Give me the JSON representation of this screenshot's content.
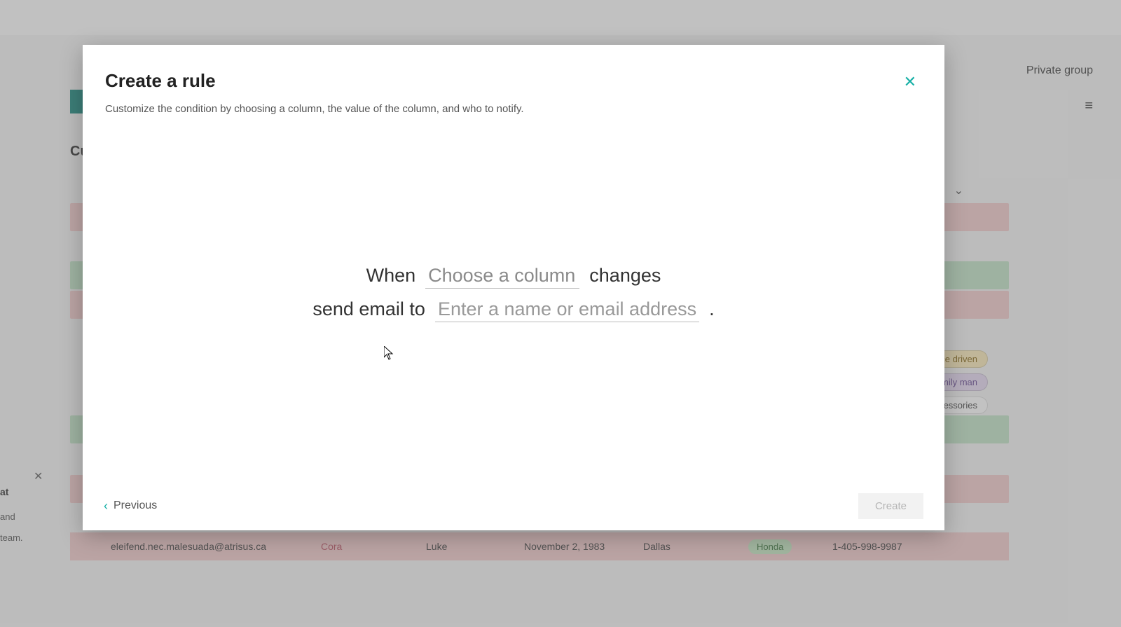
{
  "background": {
    "small_title": "",
    "private_label": "Private group",
    "left_at": "at",
    "left_and": "and",
    "left_team": "team.",
    "cu_label": "Cu",
    "tags": {
      "t1": "ce driven",
      "t2": "mily man",
      "t3": "ccessories"
    },
    "row": {
      "email": "eleifend.nec.malesuada@atrisus.ca",
      "c2": "Cora",
      "c3": "Luke",
      "c4": "November 2, 1983",
      "c5": "Dallas",
      "chip": "Honda",
      "phone": "1-405-998-9987"
    }
  },
  "modal": {
    "title": "Create a rule",
    "subtitle": "Customize the condition by choosing a column, the value of the column, and who to notify.",
    "line1_prefix": "When",
    "column_placeholder": "Choose a column",
    "line1_suffix": "changes",
    "line2_prefix": "send email to",
    "recipient_placeholder": "Enter a name or email address",
    "line2_suffix": ".",
    "previous_label": "Previous",
    "create_label": "Create"
  }
}
